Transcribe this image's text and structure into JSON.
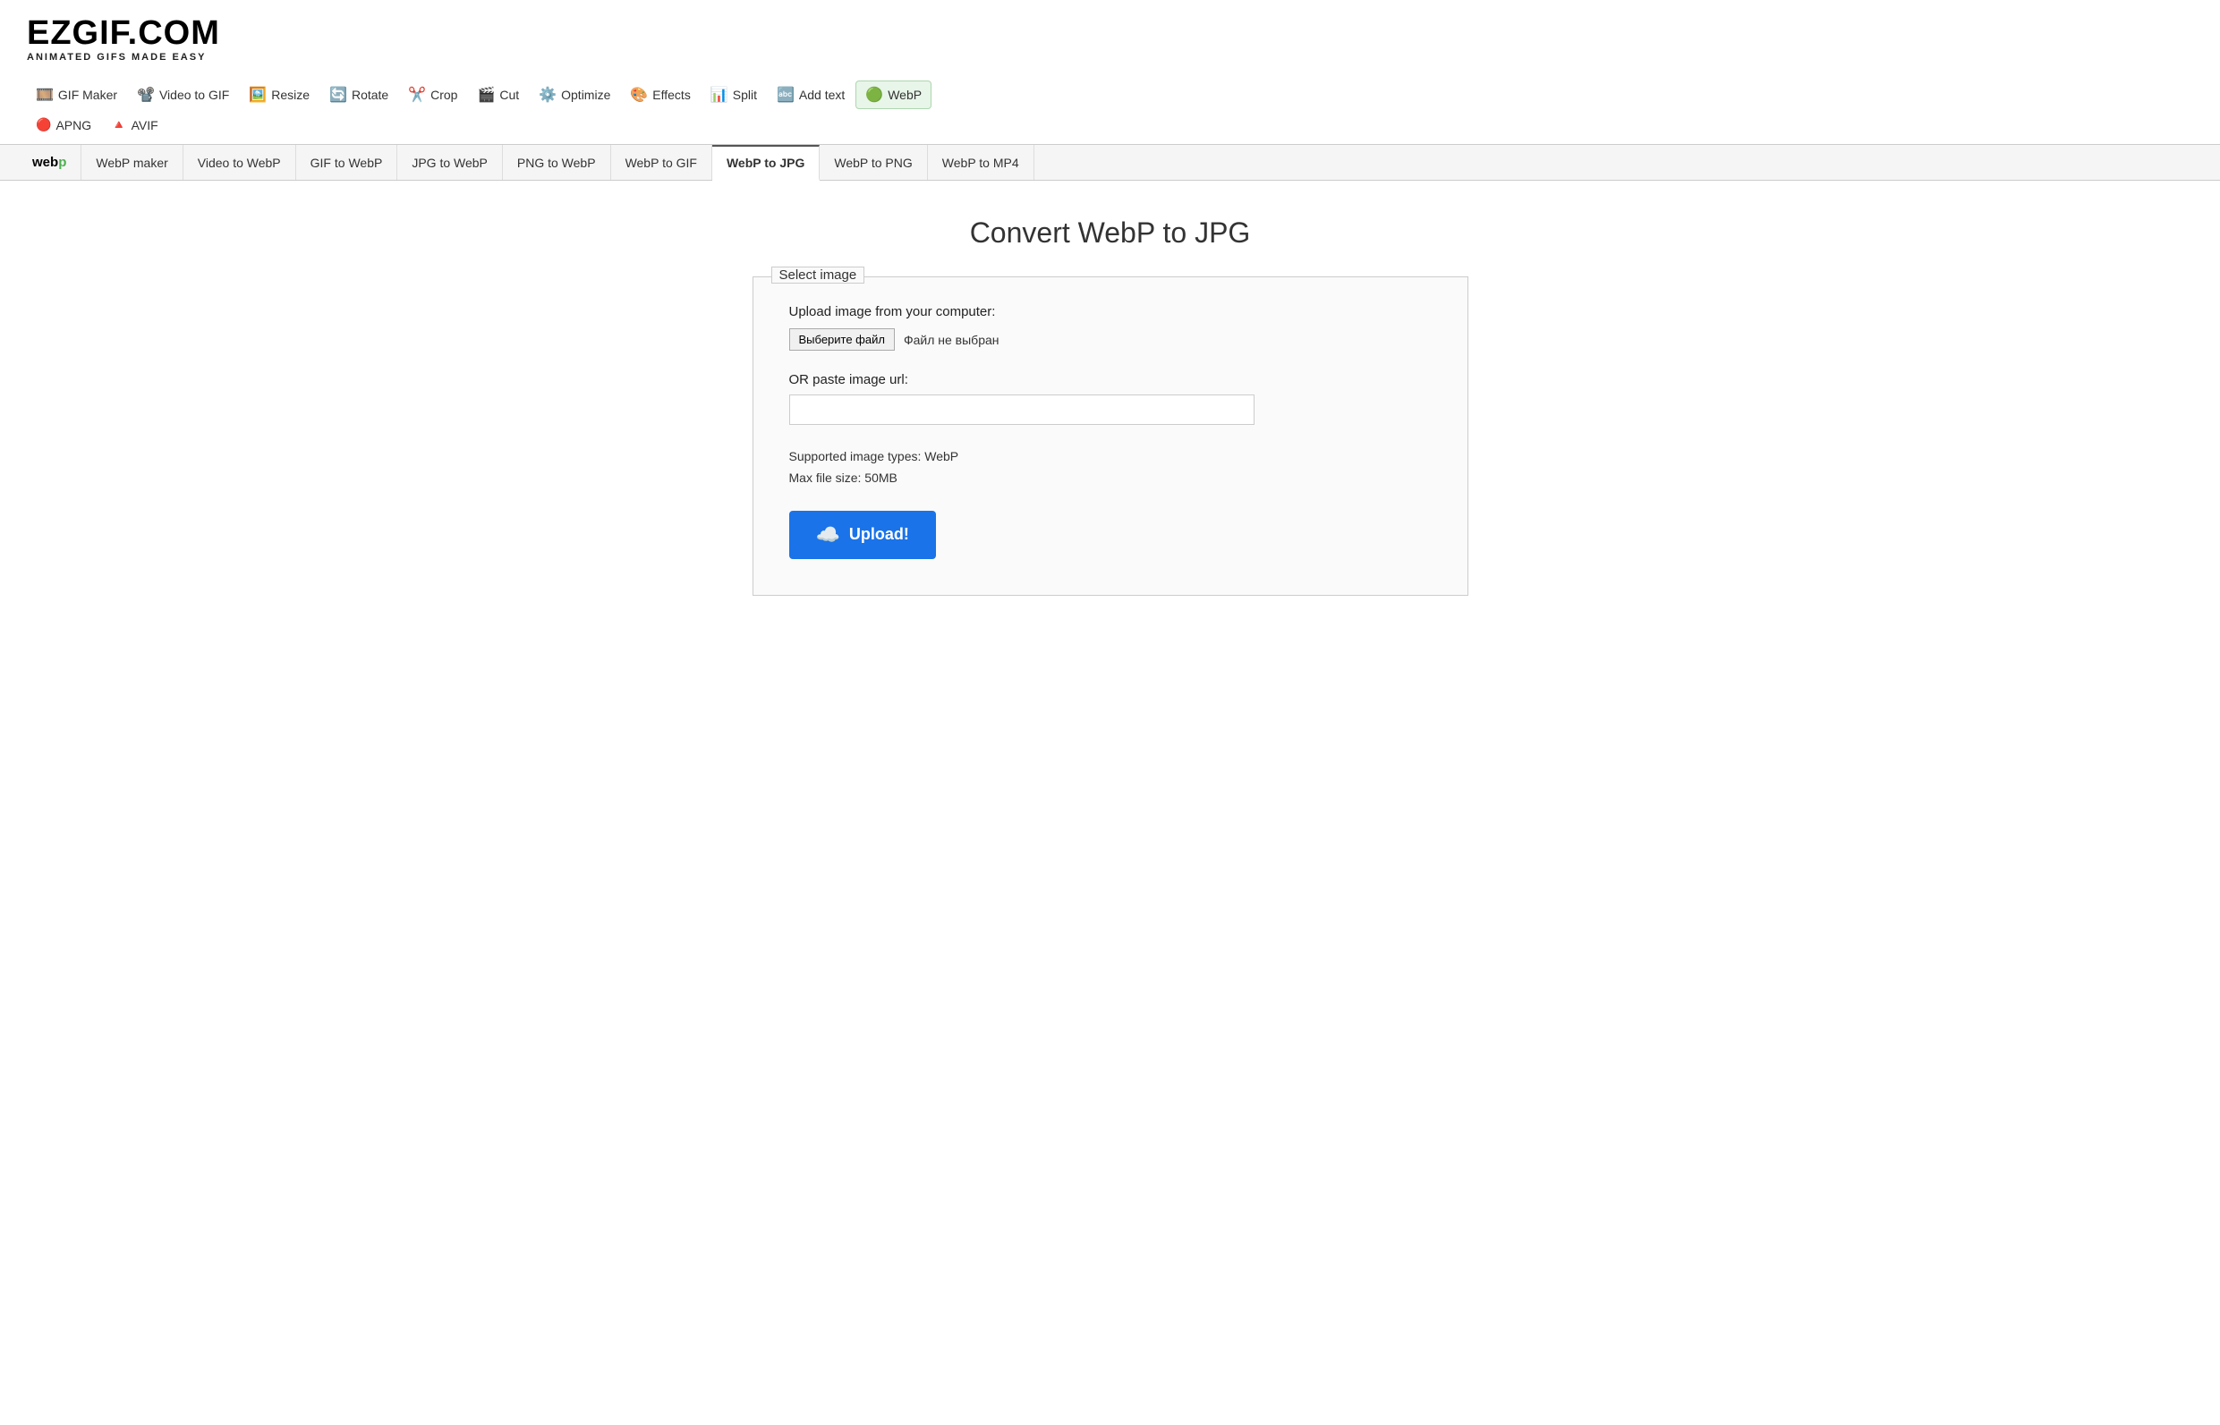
{
  "logo": {
    "text": "EZGIF.COM",
    "subtitle": "ANIMATED GIFS MADE EASY"
  },
  "top_nav": {
    "items": [
      {
        "label": "GIF Maker",
        "icon": "🎞️",
        "href": "#"
      },
      {
        "label": "Video to GIF",
        "icon": "📽️",
        "href": "#"
      },
      {
        "label": "Resize",
        "icon": "🖼️",
        "href": "#"
      },
      {
        "label": "Rotate",
        "icon": "🔄",
        "href": "#"
      },
      {
        "label": "Crop",
        "icon": "✂️",
        "href": "#"
      },
      {
        "label": "Cut",
        "icon": "🎬",
        "href": "#"
      },
      {
        "label": "Optimize",
        "icon": "⚙️",
        "href": "#"
      },
      {
        "label": "Effects",
        "icon": "🎨",
        "href": "#"
      },
      {
        "label": "Split",
        "icon": "📊",
        "href": "#"
      },
      {
        "label": "Add text",
        "icon": "🔤",
        "href": "#"
      },
      {
        "label": "WebP",
        "icon": "🟢",
        "href": "#",
        "highlight": true
      }
    ]
  },
  "second_nav": {
    "items": [
      {
        "label": "APNG",
        "icon": "🔴",
        "href": "#"
      },
      {
        "label": "AVIF",
        "icon": "🔺",
        "href": "#"
      }
    ]
  },
  "sub_tabs": {
    "logo_text": "webp",
    "logo_green_char": "p",
    "items": [
      {
        "label": "WebP maker",
        "active": false
      },
      {
        "label": "Video to WebP",
        "active": false
      },
      {
        "label": "GIF to WebP",
        "active": false
      },
      {
        "label": "JPG to WebP",
        "active": false
      },
      {
        "label": "PNG to WebP",
        "active": false
      },
      {
        "label": "WebP to GIF",
        "active": false
      },
      {
        "label": "WebP to JPG",
        "active": true
      },
      {
        "label": "WebP to PNG",
        "active": false
      },
      {
        "label": "WebP to MP4",
        "active": false
      }
    ]
  },
  "main": {
    "page_title": "Convert WebP to JPG",
    "upload_box": {
      "legend": "Select image",
      "upload_label": "Upload image from your computer:",
      "choose_file_btn": "Выберите файл",
      "no_file_text": "Файл не выбран",
      "or_url_label": "OR paste image url:",
      "url_placeholder": "",
      "supported_types": "Supported image types: WebP",
      "max_size": "Max file size: 50MB",
      "upload_btn_label": "Upload!"
    }
  }
}
